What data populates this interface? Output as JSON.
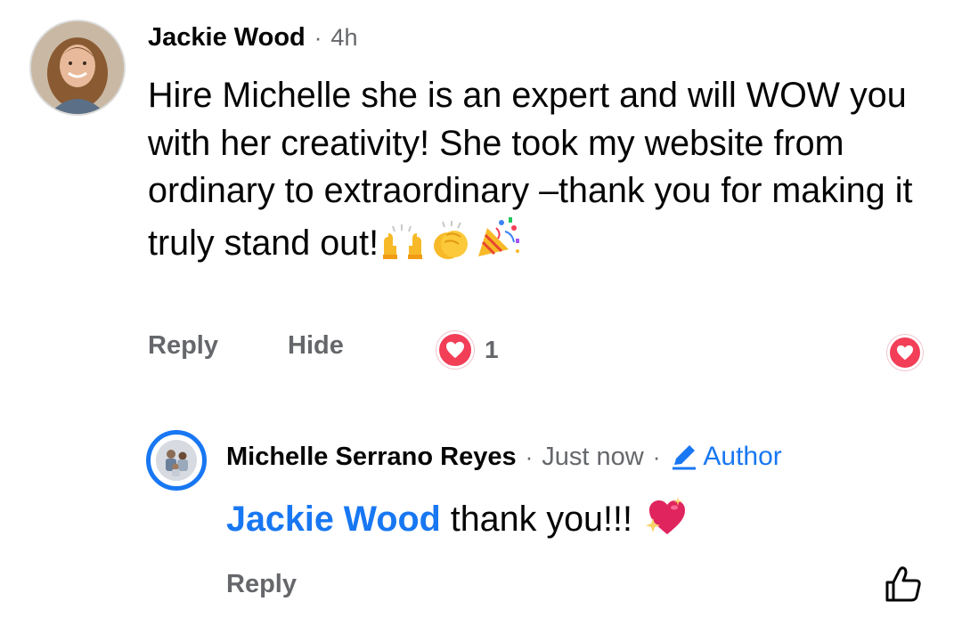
{
  "comment": {
    "author": "Jackie Wood",
    "separator": "·",
    "time": "4h",
    "text": "Hire Michelle she is an expert and will WOW you with her creativity! She took my website from ordinary to extraordinary –thank you for making it truly stand out!",
    "emojis": [
      "raising-hands-icon",
      "clapping-hands-icon",
      "party-popper-icon"
    ],
    "actions": {
      "reply": "Reply",
      "hide": "Hide"
    },
    "reaction": {
      "type": "love-icon",
      "count": "1"
    }
  },
  "reply": {
    "author": "Michelle Serrano Reyes",
    "separator": "·",
    "time": "Just now",
    "badge": "Author",
    "mention": "Jackie Wood",
    "text": " thank you!!! ",
    "emoji": "sparkling-heart-icon",
    "actions": {
      "reply": "Reply"
    }
  },
  "colors": {
    "link_blue": "#1877f2",
    "secondary_text": "#65676b",
    "love_red": "#f33e58"
  }
}
